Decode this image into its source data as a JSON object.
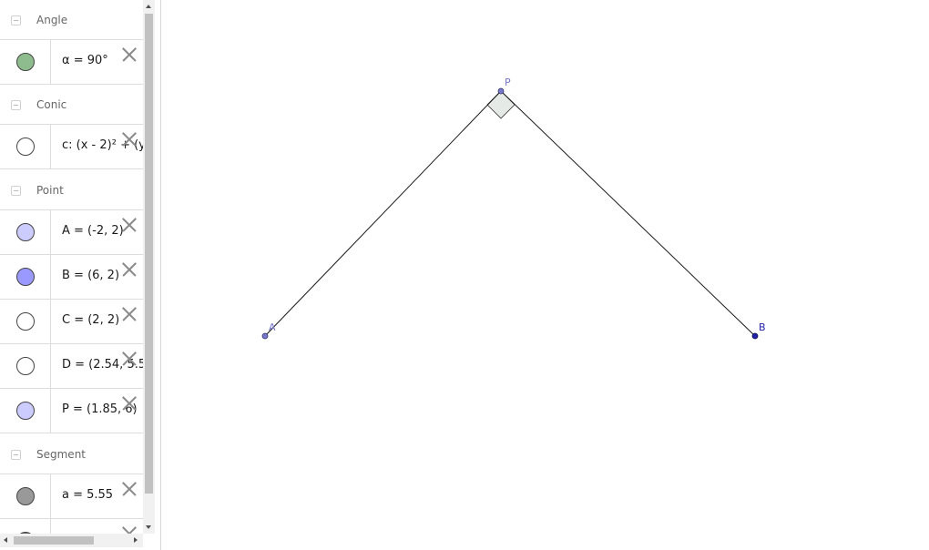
{
  "algebra": {
    "groups": [
      {
        "label": "Angle",
        "items": [
          {
            "text": "α = 90°",
            "marble_color": "#8fbc8f"
          }
        ]
      },
      {
        "label": "Conic",
        "items": [
          {
            "text": "c: (x - 2)² + (y",
            "marble_color": "#ffffff"
          }
        ]
      },
      {
        "label": "Point",
        "items": [
          {
            "text": "A = (-2, 2)",
            "marble_color": "#ccccff"
          },
          {
            "text": "B = (6, 2)",
            "marble_color": "#9999ff"
          },
          {
            "text": "C = (2, 2)",
            "marble_color": "#ffffff"
          },
          {
            "text": "D = (2.54, 5.5",
            "marble_color": "#ffffff"
          },
          {
            "text": "P = (1.85, 6)",
            "marble_color": "#ccccff"
          }
        ]
      },
      {
        "label": "Segment",
        "items": [
          {
            "text": "a = 5.55",
            "marble_color": "#999999"
          }
        ]
      }
    ]
  },
  "graphics": {
    "points": [
      {
        "name": "A",
        "color": "#7777cc"
      },
      {
        "name": "B",
        "color": "#2222aa"
      },
      {
        "name": "P",
        "color": "#7777cc"
      }
    ],
    "angle_fill": "#e6eae6"
  }
}
